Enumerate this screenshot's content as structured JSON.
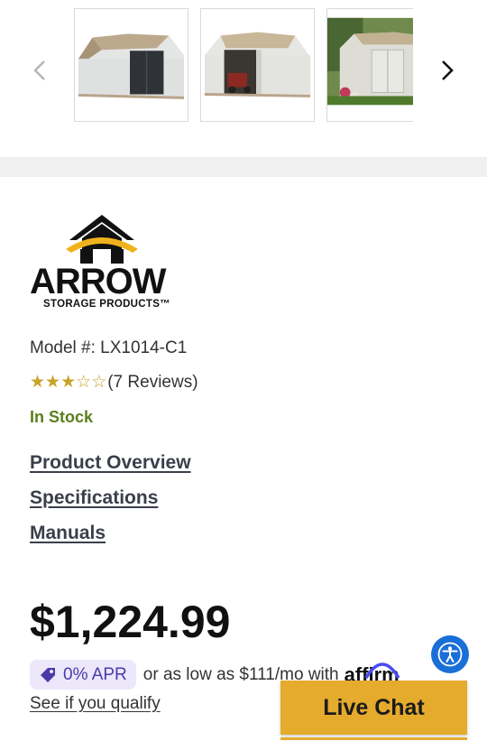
{
  "carousel": {
    "thumbnails": [
      {
        "alt": "shed-front-closed"
      },
      {
        "alt": "shed-open-with-mower"
      },
      {
        "alt": "shed-in-garden"
      }
    ]
  },
  "brand": {
    "name": "ARROW",
    "subtitle": "STORAGE PRODUCTS™"
  },
  "product": {
    "model_label": "Model #: LX1014-C1",
    "rating": 2.5,
    "rating_max": 5,
    "reviews_label": "(7 Reviews)",
    "stock_status": "In Stock",
    "price": "$1,224.99"
  },
  "nav": {
    "overview": "Product Overview",
    "specs": "Specifications",
    "manuals": "Manuals"
  },
  "financing": {
    "apr_label": "0% APR",
    "text": "or as low as $111/mo with",
    "provider": "affirm",
    "qualify_label": "See if you qualify"
  },
  "live_chat": {
    "label": "Live Chat"
  },
  "colors": {
    "stars": "#c9a227",
    "in_stock": "#5a7f1f",
    "live_chat_bg": "#e5ab2c",
    "accessibility_bg": "#1a6ed8",
    "apr_pill_bg": "#ece7fb"
  }
}
